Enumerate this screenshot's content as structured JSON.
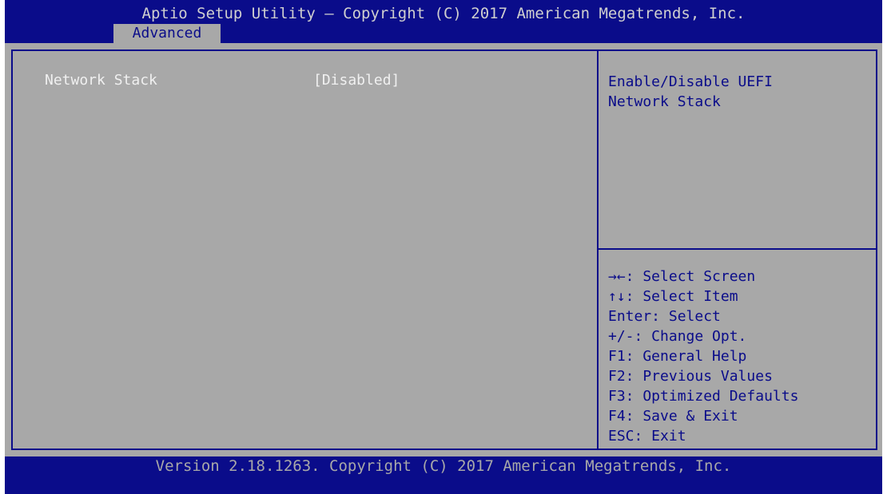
{
  "header": {
    "title": "Aptio Setup Utility – Copyright (C) 2017 American Megatrends, Inc.",
    "active_tab": "Advanced"
  },
  "settings": [
    {
      "label": "Network Stack",
      "value": "[Disabled]"
    }
  ],
  "help": {
    "description": "Enable/Disable UEFI\nNetwork Stack"
  },
  "keys": [
    "→←: Select Screen",
    "↑↓: Select Item",
    "Enter: Select",
    "+/-: Change Opt.",
    "F1: General Help",
    "F2: Previous Values",
    "F3: Optimized Defaults",
    "F4: Save & Exit",
    "ESC: Exit"
  ],
  "footer": {
    "version": "Version 2.18.1263. Copyright (C) 2017 American Megatrends, Inc."
  },
  "colors": {
    "bar_blue": "#0a0c8a",
    "panel_gray": "#a8a8a8",
    "selected_text": "#f0f0f0",
    "help_text": "#0a0c8a"
  }
}
